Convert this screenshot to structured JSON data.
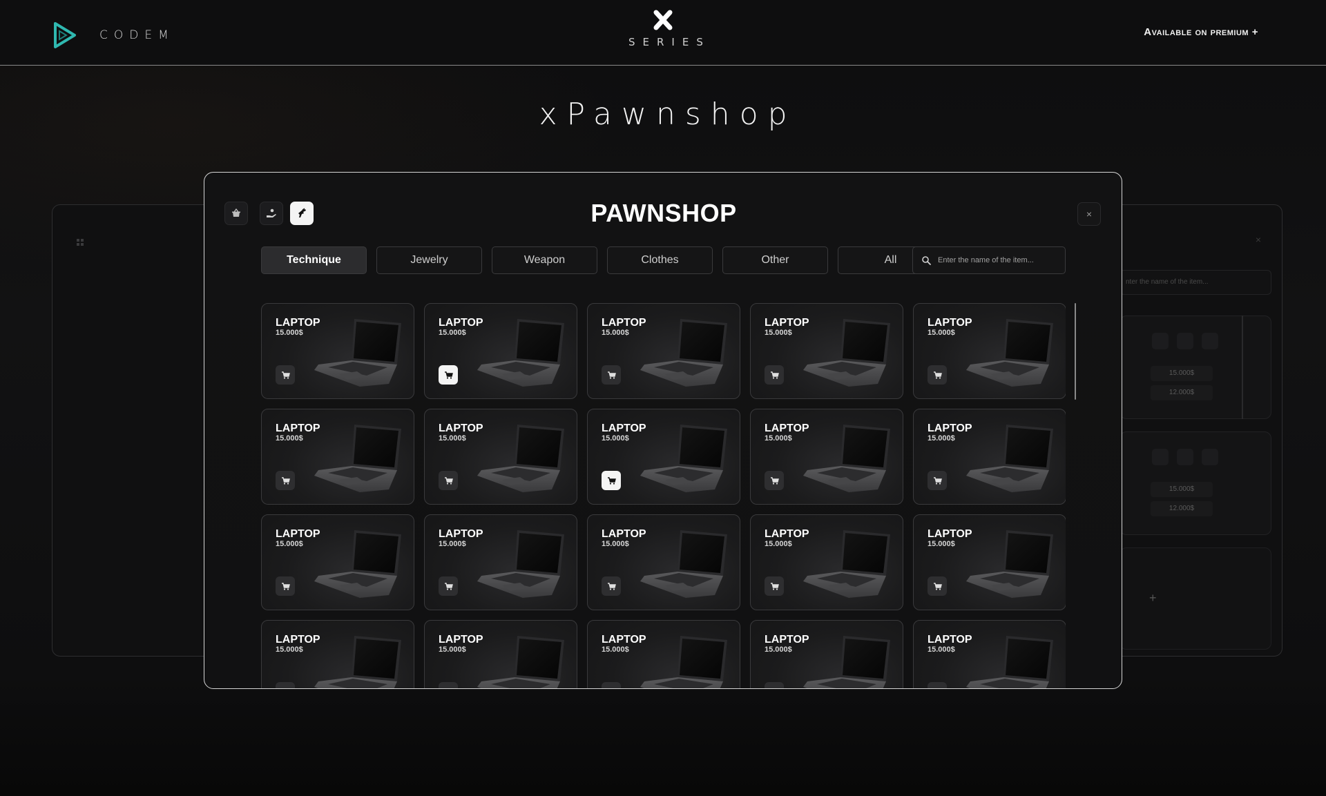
{
  "header": {
    "brand_name": "CODEM",
    "series_label": "SERIES",
    "premium_text": "Available on premium +"
  },
  "page_title": "xPawnshop",
  "right_panel": {
    "search_placeholder": "nter the name of the item...",
    "values_card1": [
      "15.000$",
      "12.000$"
    ],
    "values_card2": [
      "15.000$",
      "12.000$"
    ],
    "plus": "+"
  },
  "modal": {
    "title": "PAWNSHOP",
    "close_label": "×",
    "modes": [
      "basket-icon",
      "hand-coin-icon",
      "hand-pointing-icon"
    ],
    "active_mode": 2,
    "tabs": [
      "Technique",
      "Jewelry",
      "Weapon",
      "Clothes",
      "Other",
      "All"
    ],
    "active_tab": 0,
    "search_placeholder": "Enter the name of the item...",
    "items": [
      {
        "name": "LAPTOP",
        "price": "15.000$",
        "cart_active": false
      },
      {
        "name": "LAPTOP",
        "price": "15.000$",
        "cart_active": true
      },
      {
        "name": "LAPTOP",
        "price": "15.000$",
        "cart_active": false
      },
      {
        "name": "LAPTOP",
        "price": "15.000$",
        "cart_active": false
      },
      {
        "name": "LAPTOP",
        "price": "15.000$",
        "cart_active": false
      },
      {
        "name": "LAPTOP",
        "price": "15.000$",
        "cart_active": false
      },
      {
        "name": "LAPTOP",
        "price": "15.000$",
        "cart_active": false
      },
      {
        "name": "LAPTOP",
        "price": "15.000$",
        "cart_active": true
      },
      {
        "name": "LAPTOP",
        "price": "15.000$",
        "cart_active": false
      },
      {
        "name": "LAPTOP",
        "price": "15.000$",
        "cart_active": false
      },
      {
        "name": "LAPTOP",
        "price": "15.000$",
        "cart_active": false
      },
      {
        "name": "LAPTOP",
        "price": "15.000$",
        "cart_active": false
      },
      {
        "name": "LAPTOP",
        "price": "15.000$",
        "cart_active": false
      },
      {
        "name": "LAPTOP",
        "price": "15.000$",
        "cart_active": false
      },
      {
        "name": "LAPTOP",
        "price": "15.000$",
        "cart_active": false
      },
      {
        "name": "LAPTOP",
        "price": "15.000$",
        "cart_active": false
      },
      {
        "name": "LAPTOP",
        "price": "15.000$",
        "cart_active": false
      },
      {
        "name": "LAPTOP",
        "price": "15.000$",
        "cart_active": false
      },
      {
        "name": "LAPTOP",
        "price": "15.000$",
        "cart_active": false
      },
      {
        "name": "LAPTOP",
        "price": "15.000$",
        "cart_active": false
      }
    ]
  },
  "colors": {
    "accent_teal": "#2fb8b0",
    "background": "#0f0f10",
    "active_white": "#f4f4f4"
  }
}
